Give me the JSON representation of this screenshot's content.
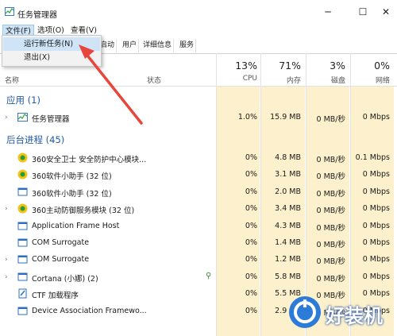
{
  "window": {
    "title": "任务管理器",
    "buttons": [
      "─",
      "☐",
      "✕"
    ]
  },
  "menubar": {
    "items": [
      "文件(F)",
      "选项(O)",
      "查看(V)"
    ]
  },
  "file_menu": {
    "items": [
      "运行新任务(N)",
      "退出(X)"
    ]
  },
  "tabs": [
    "启动",
    "用户",
    "详细信息",
    "服务"
  ],
  "header": {
    "name": "名称",
    "status": "状态",
    "columns": [
      {
        "pct": "13%",
        "label": "CPU"
      },
      {
        "pct": "71%",
        "label": "内存"
      },
      {
        "pct": "3%",
        "label": "磁盘"
      },
      {
        "pct": "0%",
        "label": "网络"
      }
    ]
  },
  "sections": {
    "apps": "应用 (1)",
    "background": "后台进程 (45)"
  },
  "apps": [
    {
      "name": "任务管理器",
      "cpu": "1.0%",
      "mem": "15.9 MB",
      "disk": "0 MB/秒",
      "net": "0 Mbps",
      "icon": "task-manager-icon"
    }
  ],
  "background": [
    {
      "name": "360安全卫士 安全防护中心模块...",
      "cpu": "0%",
      "mem": "4.8 MB",
      "disk": "0 MB/秒",
      "net": "0.1 Mbps",
      "icon": "360-icon",
      "expand": false
    },
    {
      "name": "360软件小助手 (32 位)",
      "cpu": "0%",
      "mem": "3.1 MB",
      "disk": "0 MB/秒",
      "net": "0 Mbps",
      "icon": "360-icon",
      "expand": false
    },
    {
      "name": "360软件小助手 (32 位)",
      "cpu": "0%",
      "mem": "2.0 MB",
      "disk": "0 MB/秒",
      "net": "0 Mbps",
      "icon": "window-icon",
      "expand": false
    },
    {
      "name": "360主动防御服务模块 (32 位)",
      "cpu": "0%",
      "mem": "3.4 MB",
      "disk": "0 MB/秒",
      "net": "0 Mbps",
      "icon": "360-icon",
      "expand": true
    },
    {
      "name": "Application Frame Host",
      "cpu": "0%",
      "mem": "4.3 MB",
      "disk": "0 MB/秒",
      "net": "0 Mbps",
      "icon": "app-window-icon",
      "expand": false
    },
    {
      "name": "COM Surrogate",
      "cpu": "0%",
      "mem": "1.4 MB",
      "disk": "0 MB/秒",
      "net": "0 Mbps",
      "icon": "app-window-icon",
      "expand": false
    },
    {
      "name": "COM Surrogate",
      "cpu": "0%",
      "mem": "1.2 MB",
      "disk": "0 MB/秒",
      "net": "0 Mbps",
      "icon": "app-window-icon",
      "expand": true
    },
    {
      "name": "Cortana (小娜) (2)",
      "cpu": "0%",
      "mem": "5.8 MB",
      "disk": "0 MB/秒",
      "net": "0 Mbps",
      "icon": "app-window-icon",
      "expand": true,
      "leaf": true
    },
    {
      "name": "CTF 加载程序",
      "cpu": "0%",
      "mem": "5.5 MB",
      "disk": "0 MB/秒",
      "net": "0 Mbps",
      "icon": "ctf-icon",
      "expand": false
    },
    {
      "name": "Device Association Framewo...",
      "cpu": "0%",
      "mem": "2.9 MB",
      "disk": "0 MB/秒",
      "net": "0 Mbps",
      "icon": "app-window-icon",
      "expand": false
    }
  ],
  "watermark": {
    "text": "好装机"
  },
  "colors": {
    "accent": "#1f5aa8",
    "highlight": "#fcf1cc",
    "arrow": "#e8453c",
    "menu_hl": "#cfe5f7"
  }
}
